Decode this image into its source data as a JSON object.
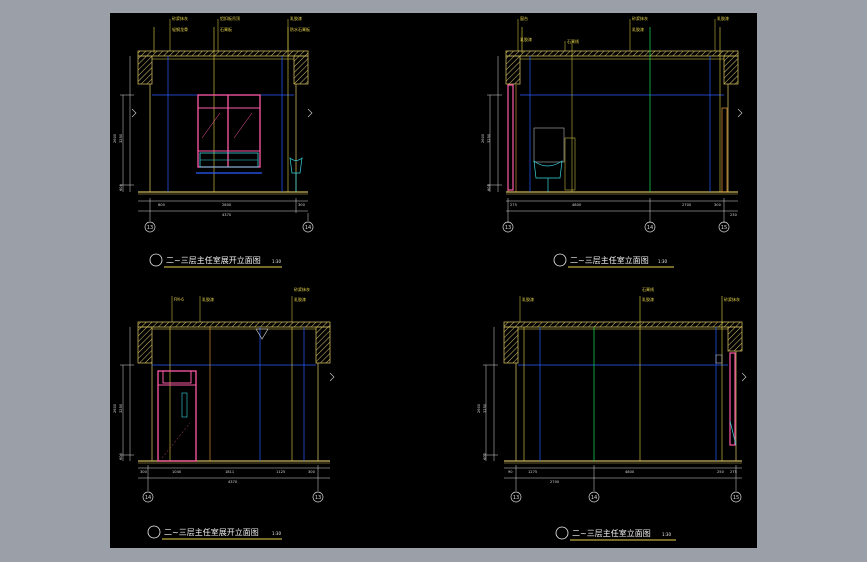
{
  "colors": {
    "wall": "#c8b45a",
    "hatch": "#d9c46a",
    "grid_blue": "#2a5cff",
    "grid_green": "#19c94b",
    "grid_yellow": "#e8d44a",
    "grid_orange": "#f0a040",
    "window_magenta": "#ff5aa8",
    "cyan": "#38d8e0",
    "dim_white": "#d8d8d8",
    "title_white": "#f2f2f2",
    "underline": "#e8d44a"
  },
  "panels": [
    {
      "id": "tl",
      "title": "二~三层主任室展开立面图",
      "scale": "1:30",
      "dims_bottom": [
        "600",
        "2800",
        "300"
      ],
      "dims_total": "4370",
      "height_dims": [
        "2600",
        "3250",
        "600"
      ],
      "axis_labels": [
        "13",
        "14"
      ],
      "leaders": [
        "砂浆抹灰",
        "轻钢龙骨",
        "铝扣板吊顶",
        "石膏板",
        "乳胶漆",
        "防水石膏板"
      ]
    },
    {
      "id": "tr",
      "title": "二~三层主任室立面图",
      "scale": "1:30",
      "dims_bottom": [
        "275",
        "4800",
        "2700",
        "300",
        "230"
      ],
      "dims_total": "",
      "height_dims": [
        "2600",
        "3250",
        "600"
      ],
      "axis_labels": [
        "13",
        "14",
        "15"
      ],
      "leaders": [
        "窗台",
        "乳胶漆",
        "石膏线",
        "砂浆抹灰",
        "乳胶漆",
        "乳胶漆"
      ]
    },
    {
      "id": "bl",
      "title": "二~三层主任室展开立面图",
      "scale": "1:30",
      "dims_bottom": [
        "300",
        "1040",
        "1811",
        "1125",
        "300"
      ],
      "dims_total": "4370",
      "height_dims": [
        "2600",
        "3250",
        "600"
      ],
      "axis_labels": [
        "14",
        "13"
      ],
      "leaders": [
        "FM-6",
        "乳胶漆",
        "砂浆抹灰",
        "乳胶漆"
      ]
    },
    {
      "id": "br",
      "title": "二~三层主任室立面图",
      "scale": "1:30",
      "dims_bottom": [
        "90",
        "1275",
        "2700",
        "4800",
        "250",
        "275"
      ],
      "dims_total": "",
      "height_dims": [
        "2600",
        "3250",
        "600"
      ],
      "axis_labels": [
        "13",
        "14",
        "15"
      ],
      "leaders": [
        "乳胶漆",
        "石膏线",
        "乳胶漆",
        "砂浆抹灰"
      ]
    }
  ]
}
